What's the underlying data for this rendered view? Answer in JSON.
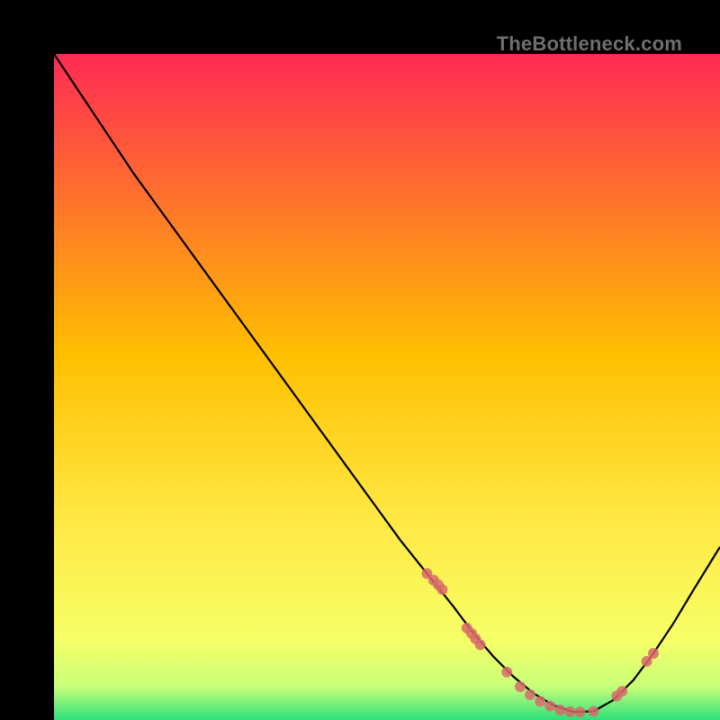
{
  "watermark": "TheBottleneck.com",
  "colors": {
    "bg_black": "#000000",
    "grad_top": "#ff2a55",
    "grad_mid": "#ffd400",
    "grad_low": "#f6ff66",
    "grad_green": "#2de07a",
    "curve": "#000000",
    "marker": "#d86a6a"
  },
  "chart_data": {
    "type": "line",
    "title": "",
    "xlabel": "",
    "ylabel": "",
    "xlim": [
      0,
      100
    ],
    "ylim": [
      0,
      100
    ],
    "grid": false,
    "legend": false,
    "curve": {
      "x": [
        0,
        4,
        8,
        12,
        16,
        20,
        24,
        28,
        32,
        36,
        40,
        44,
        48,
        52,
        56,
        60,
        63,
        66,
        69,
        72,
        75,
        78,
        81,
        84,
        87,
        90,
        93,
        96,
        100
      ],
      "y": [
        100,
        94,
        88,
        82,
        76.5,
        71,
        65.5,
        60,
        54.5,
        49,
        43.5,
        38,
        32.5,
        27,
        22,
        17,
        13,
        9.5,
        6.5,
        4,
        2.2,
        1.2,
        1.3,
        3,
        6,
        10,
        14.5,
        19.5,
        26
      ]
    },
    "markers": {
      "x": [
        56,
        57,
        57.7,
        58.3,
        62,
        62.7,
        63.3,
        64,
        68,
        70,
        71.5,
        73,
        74.5,
        76,
        77.5,
        79,
        81,
        84.5,
        85.3,
        89,
        90
      ],
      "y": [
        22,
        21,
        20.3,
        19.6,
        13.8,
        13,
        12.2,
        11.3,
        7.2,
        5,
        3.8,
        2.8,
        2.1,
        1.5,
        1.25,
        1.2,
        1.3,
        3.6,
        4.3,
        8.8,
        10
      ]
    }
  }
}
